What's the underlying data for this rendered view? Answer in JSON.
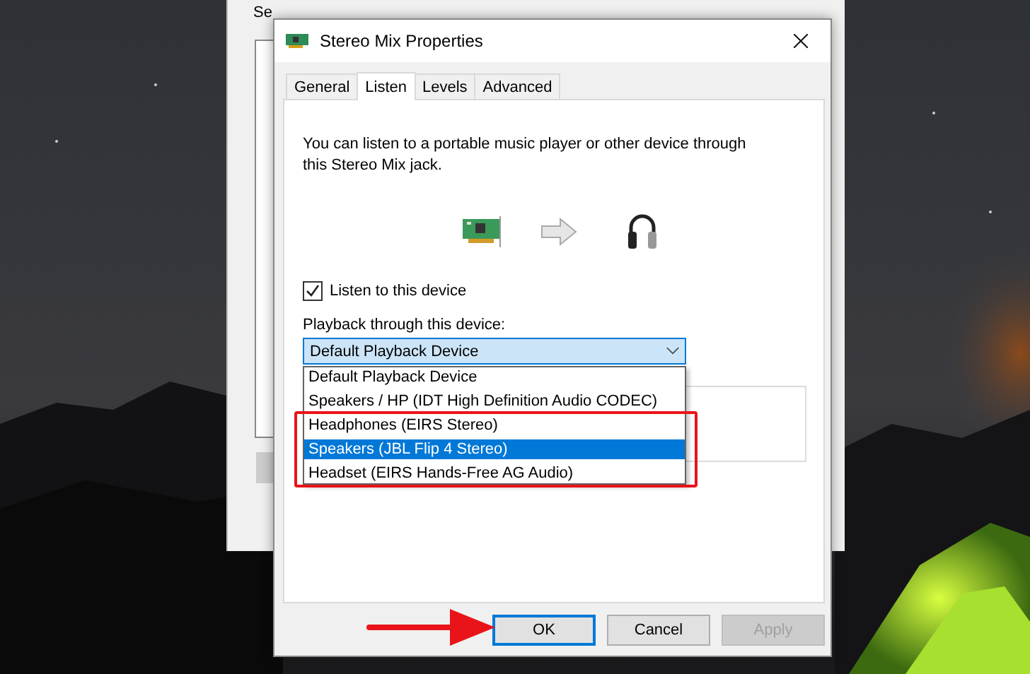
{
  "background_window": {
    "text": "Se"
  },
  "dialog": {
    "title": "Stereo Mix Properties",
    "tabs": [
      {
        "label": "General",
        "selected": false
      },
      {
        "label": "Listen",
        "selected": true
      },
      {
        "label": "Levels",
        "selected": false
      },
      {
        "label": "Advanced",
        "selected": false
      }
    ],
    "description": "You can listen to a portable music player or other device through this Stereo Mix jack.",
    "listen_checkbox": {
      "label": "Listen to this device",
      "checked": true
    },
    "playback": {
      "label": "Playback through this device:",
      "value": "Default Playback Device",
      "expanded": true,
      "options": [
        {
          "label": "Default Playback Device",
          "highlighted": false
        },
        {
          "label": "Speakers / HP (IDT High Definition Audio CODEC)",
          "highlighted": false
        },
        {
          "label": "Headphones (EIRS Stereo)",
          "highlighted": false
        },
        {
          "label": "Speakers (JBL Flip 4 Stereo)",
          "highlighted": true
        },
        {
          "label": "Headset (EIRS Hands-Free AG Audio)",
          "highlighted": false
        }
      ]
    },
    "buttons": [
      {
        "label": "OK",
        "kind": "default"
      },
      {
        "label": "Cancel",
        "kind": "normal"
      },
      {
        "label": "Apply",
        "kind": "disabled"
      }
    ]
  }
}
